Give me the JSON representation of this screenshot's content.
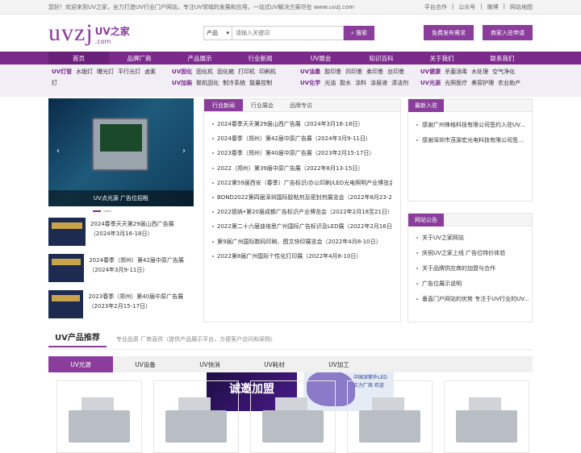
{
  "topbar": {
    "welcome": "您好！欢迎来到UV之家，全力打造UV行业门户网站，专注UV领域的发展和应用，一站式UV解决方案尽在 www.uvzj.com",
    "links": [
      "平台合作",
      "公众号",
      "微博",
      "网站地图"
    ]
  },
  "logo": {
    "text": "uvzj",
    "cn": "UV之家",
    "domain": ".com"
  },
  "search": {
    "category": "产品",
    "placeholder": "请输入关键词",
    "button": "搜索"
  },
  "header_buttons": {
    "post": "免费发布需求",
    "join": "商家入驻申请"
  },
  "nav": [
    "首页",
    "品牌厂商",
    "产品展示",
    "行业新闻",
    "UV展会",
    "知识百科",
    "关于我们",
    "联系我们"
  ],
  "categories": [
    {
      "rows": [
        [
          "UV灯管",
          "水银灯",
          "曝光灯",
          "平行光灯",
          "卤素"
        ],
        [
          "灯"
        ]
      ]
    },
    {
      "rows": [
        [
          "UV固化",
          "固化机",
          "固化箱",
          "打印机",
          "印刷机"
        ],
        [
          "UV加装",
          "联机固化",
          "制冷系统",
          "能量控制"
        ]
      ]
    },
    {
      "rows": [
        [
          "UV油墨",
          "胶印墨",
          "凹印墨",
          "柔印墨",
          "丝印墨"
        ],
        [
          "UV化学",
          "光油",
          "胶水",
          "涂料",
          "涂层液",
          "清洁剂"
        ]
      ]
    },
    {
      "rows": [
        [
          "UV健康",
          "杀菌消毒",
          "水处理",
          "空气净化"
        ],
        [
          "UV光源",
          "光照医疗",
          "美容护理",
          "农业助产"
        ]
      ]
    }
  ],
  "slider": {
    "caption": "UV点光源 广告位招租"
  },
  "left_news": [
    {
      "title": "2024春季天天第29届山西广告展（2024年3月16-18日）"
    },
    {
      "title": "2024春季（郑州）第42届中原广告展（2024年3月9-11日）"
    },
    {
      "title": "2023春季（郑州）第40届中原广告展（2023年2月15-17日）"
    }
  ],
  "tabs": [
    "行业新闻",
    "行业展会",
    "品牌专访"
  ],
  "news_list": [
    "2024春季天天第29届山西广告展（2024年3月16-18日）",
    "2024春季（郑州）第42届中原广告展（2024年3月9-11日）",
    "2023春季（郑州）第40届中原广告展（2023年2月15-17日）",
    "2022（郑州）第39届中原广告展（2022年8月13-15日）",
    "2022第59届西安（春季）广告标识/办公印刷/LED光电照明产业博览会...",
    "BOND2022第四届深圳国际胶粘剂及密封剂展览会（2022年8月23-25日）",
    "2022德纳•第20届成都广告标识产业博览会（2022年2月18至21日）",
    "2022第二十六届迪培思广州国际广告标识及LED展（2022年2月16日-18...",
    "第9届广州国际数码印刷、图文快印展览会（2022年4月8-10日）",
    "2022第8届广州国际个性化打印展（2022年4月8-10日）"
  ],
  "banners": {
    "b1": "诚邀加盟",
    "b2": "中国深紫外LED 实力厂商 欢迎"
  },
  "new_members": {
    "title": "最新入驻",
    "items": [
      "感谢广州锋格科技有限公司签约入驻UV...",
      "感谢深圳市茂源宏光电科技有限公司签..."
    ]
  },
  "notices": {
    "title": "网站公告",
    "items": [
      "关于UV之家网站",
      "庆祝UV之家上线 广告位特价体验",
      "关于品牌供应商的加盟与合作",
      "广告位展示说明",
      "垂直门户网站的优势 专注于UV行业的UV..."
    ]
  },
  "products": {
    "title": "UV产品推荐",
    "subtitle": "专业品质 厂商直供（提供产品展示平台，方便客户访问和采购）",
    "tabs": [
      "UV光源",
      "UV设备",
      "UV快消",
      "UV耗材",
      "UV加工"
    ]
  }
}
